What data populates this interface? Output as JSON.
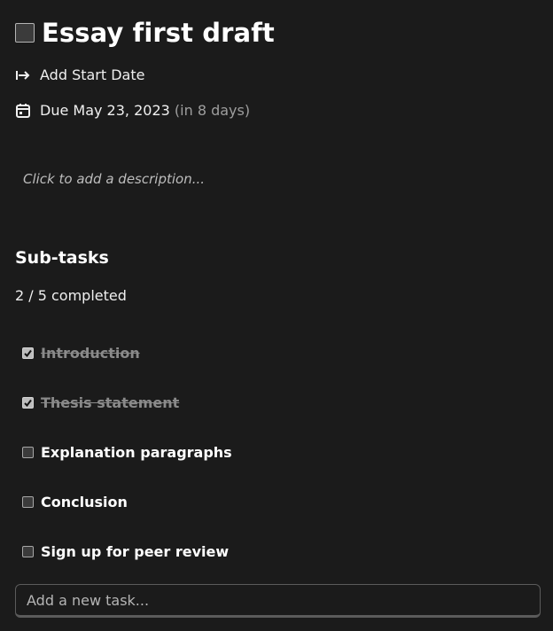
{
  "task": {
    "title": "Essay first draft",
    "start_date_label": "Add Start Date",
    "due_label": "Due May 23, 2023",
    "due_relative": "(in 8 days)",
    "description_placeholder": "Click to add a description..."
  },
  "subtasks": {
    "heading": "Sub-tasks",
    "progress_text": "2 / 5 completed",
    "items": [
      {
        "label": "Introduction",
        "done": true
      },
      {
        "label": "Thesis statement",
        "done": true
      },
      {
        "label": "Explanation paragraphs",
        "done": false
      },
      {
        "label": "Conclusion",
        "done": false
      },
      {
        "label": "Sign up for peer review",
        "done": false
      }
    ]
  },
  "add_task": {
    "placeholder": "Add a new task..."
  },
  "icons": {
    "start": "arrow-right-to-bar-icon",
    "due": "calendar-icon"
  }
}
